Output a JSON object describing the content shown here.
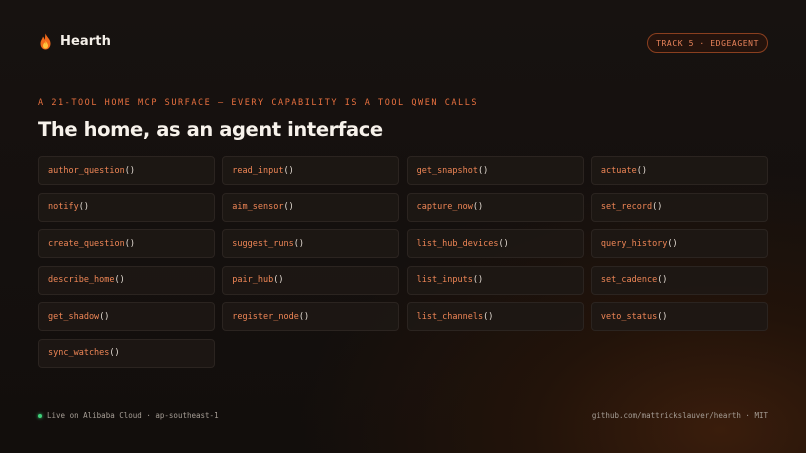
{
  "brand": {
    "name": "Hearth",
    "icon": "flame-icon"
  },
  "track_badge": "TRACK 5 · EDGEAGENT",
  "eyebrow": "A 21-TOOL HOME MCP SURFACE — EVERY CAPABILITY IS A TOOL QWEN CALLS",
  "headline": "The home, as an agent interface",
  "tools": [
    {
      "name": "author_question",
      "parens": "()"
    },
    {
      "name": "read_input",
      "parens": "()"
    },
    {
      "name": "get_snapshot",
      "parens": "()"
    },
    {
      "name": "actuate",
      "parens": "()"
    },
    {
      "name": "notify",
      "parens": "()"
    },
    {
      "name": "aim_sensor",
      "parens": "()"
    },
    {
      "name": "capture_now",
      "parens": "()"
    },
    {
      "name": "set_record",
      "parens": "()"
    },
    {
      "name": "create_question",
      "parens": "()"
    },
    {
      "name": "suggest_runs",
      "parens": "()"
    },
    {
      "name": "list_hub_devices",
      "parens": "()"
    },
    {
      "name": "query_history",
      "parens": "()"
    },
    {
      "name": "describe_home",
      "parens": "()"
    },
    {
      "name": "pair_hub",
      "parens": "()"
    },
    {
      "name": "list_inputs",
      "parens": "()"
    },
    {
      "name": "set_cadence",
      "parens": "()"
    },
    {
      "name": "get_shadow",
      "parens": "()"
    },
    {
      "name": "register_node",
      "parens": "()"
    },
    {
      "name": "list_channels",
      "parens": "()"
    },
    {
      "name": "veto_status",
      "parens": "()"
    },
    {
      "name": "sync_watches",
      "parens": "()"
    }
  ],
  "footer": {
    "status_text": "Live on Alibaba Cloud · ap-southeast-1",
    "status_color": "#3fd07a",
    "repo_text": "github.com/mattrickslauver/hearth · MIT"
  },
  "colors": {
    "accent": "#ef8656",
    "eyebrow": "#e8703f",
    "background": "#120e0c"
  }
}
